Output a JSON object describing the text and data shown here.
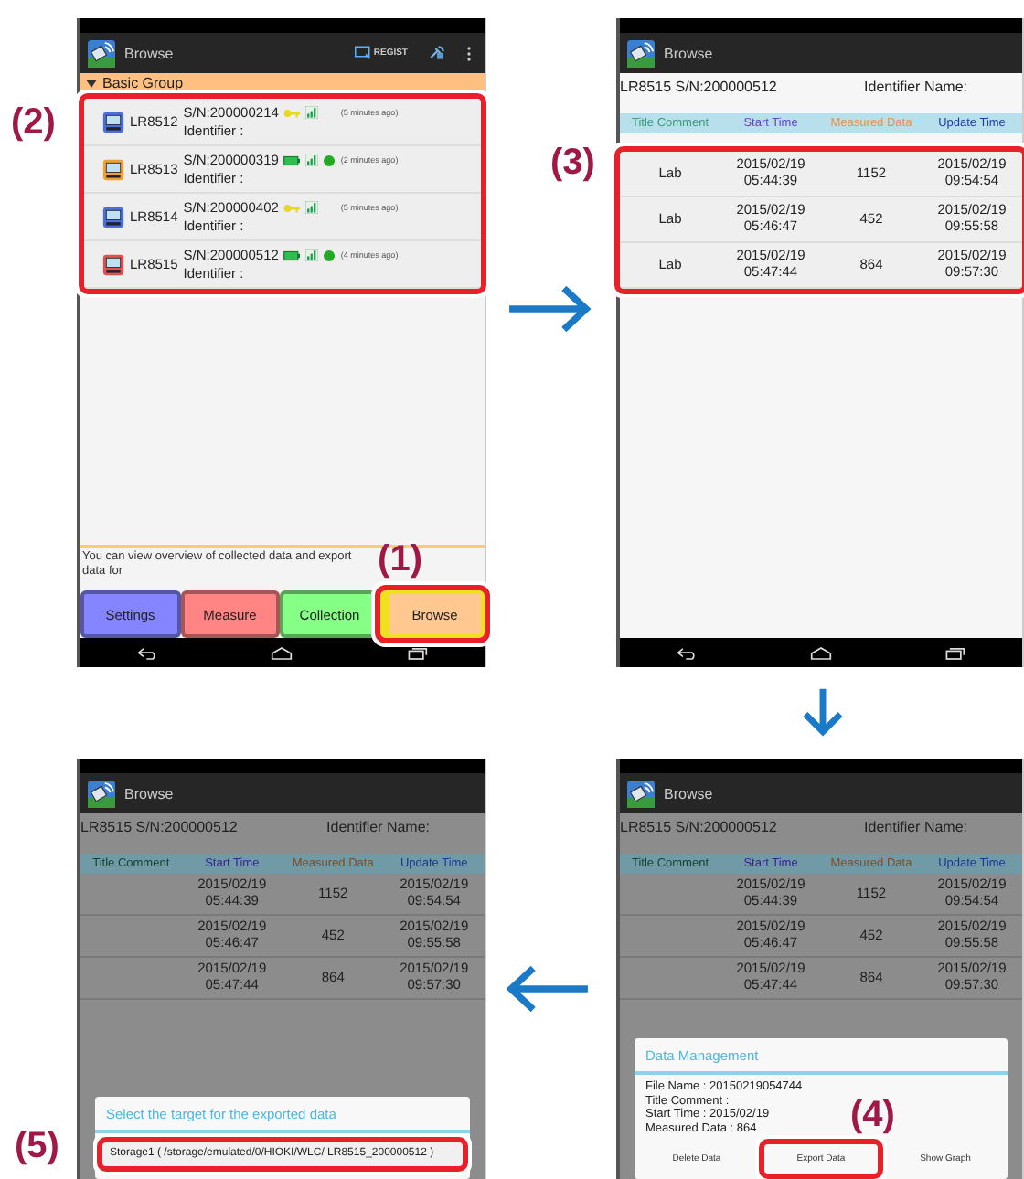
{
  "screens": [
    {
      "kind": "device_list",
      "title": "Browse",
      "regist_label": "REGIST",
      "group": "Basic Group",
      "list_callout": "(2)",
      "devices": [
        {
          "model": "LR8512",
          "serial": "S/N:200000214",
          "identifier": "Identifier :",
          "color": "#4a6fd8",
          "battery_powered": false,
          "online": false,
          "ago": "(5 minutes ago)"
        },
        {
          "model": "LR8513",
          "serial": "S/N:200000319",
          "identifier": "Identifier :",
          "color": "#f0a030",
          "battery_powered": true,
          "online": true,
          "ago": "(2 minutes ago)"
        },
        {
          "model": "LR8514",
          "serial": "S/N:200000402",
          "identifier": "Identifier :",
          "color": "#4a6fd8",
          "battery_powered": false,
          "online": false,
          "ago": "(5 minutes ago)"
        },
        {
          "model": "LR8515",
          "serial": "S/N:200000512",
          "identifier": "Identifier :",
          "color": "#e05050",
          "battery_powered": true,
          "online": true,
          "ago": "(4 minutes ago)"
        }
      ],
      "message": "You can view overview of collected data and export data for",
      "tabs": [
        {
          "label": "Settings",
          "color": "#8585ff",
          "selected": false
        },
        {
          "label": "Measure",
          "color": "#ff8585",
          "selected": false
        },
        {
          "label": "Collection",
          "color": "#85ff85",
          "selected": false
        },
        {
          "label": "Browse",
          "color": "#ffc890",
          "selected": true,
          "callout": "(1)"
        }
      ]
    },
    {
      "kind": "data_table",
      "title": "Browse",
      "dimmed": false,
      "device": "LR8515 S/N:200000512",
      "identifier_label": "Identifier Name:",
      "rows_callout": "(3)",
      "columns": [
        {
          "label": "Title Comment",
          "color": "#3b9a7a"
        },
        {
          "label": "Start Time",
          "color": "#6a3cd0"
        },
        {
          "label": "Measured Data",
          "color": "#e8904a"
        },
        {
          "label": "Update Time",
          "color": "#1f3aa8"
        }
      ],
      "rows": [
        {
          "comment": "Lab",
          "start": "2015/02/19\n05:44:39",
          "measured": "1152",
          "updated": "2015/02/19\n09:54:54"
        },
        {
          "comment": "Lab",
          "start": "2015/02/19\n05:46:47",
          "measured": "452",
          "updated": "2015/02/19\n09:55:58"
        },
        {
          "comment": "Lab",
          "start": "2015/02/19\n05:47:44",
          "measured": "864",
          "updated": "2015/02/19\n09:57:30"
        }
      ]
    },
    {
      "kind": "data_table",
      "title": "Browse",
      "dimmed": true,
      "device": "LR8515 S/N:200000512",
      "identifier_label": "Identifier Name:",
      "columns": [
        {
          "label": "Title Comment",
          "color": "#173f30"
        },
        {
          "label": "Start Time",
          "color": "#3a2290"
        },
        {
          "label": "Measured Data",
          "color": "#8a4a1a"
        },
        {
          "label": "Update Time",
          "color": "#1a3a90"
        }
      ],
      "rows": [
        {
          "start": "2015/02/19\n05:44:39",
          "measured": "1152",
          "updated": "2015/02/19\n09:54:54"
        },
        {
          "start": "2015/02/19\n05:46:47",
          "measured": "452",
          "updated": "2015/02/19\n09:55:58"
        },
        {
          "start": "2015/02/19\n05:47:44",
          "measured": "864",
          "updated": "2015/02/19\n09:57:30"
        }
      ],
      "dialog": {
        "kind": "target_select",
        "title": "Select the target for the exported data",
        "options": [
          {
            "label": "Storage1 ( /storage/emulated/0/HIOKI/WLC/ LR8515_200000512 )",
            "callout": "(5)"
          }
        ]
      }
    },
    {
      "kind": "data_table",
      "title": "Browse",
      "dimmed": true,
      "device": "LR8515 S/N:200000512",
      "identifier_label": "Identifier Name:",
      "columns": [
        {
          "label": "Title Comment",
          "color": "#173f30"
        },
        {
          "label": "Start Time",
          "color": "#3a2290"
        },
        {
          "label": "Measured Data",
          "color": "#8a4a1a"
        },
        {
          "label": "Update Time",
          "color": "#1a3a90"
        }
      ],
      "rows": [
        {
          "start": "2015/02/19\n05:44:39",
          "measured": "1152",
          "updated": "2015/02/19\n09:54:54"
        },
        {
          "start": "2015/02/19\n05:46:47",
          "measured": "452",
          "updated": "2015/02/19\n09:55:58"
        },
        {
          "start": "2015/02/19\n05:47:44",
          "measured": "864",
          "updated": "2015/02/19\n09:57:30"
        }
      ],
      "dialog": {
        "kind": "data_management",
        "title": "Data Management",
        "lines": [
          "File Name : 20150219054744",
          "Title Comment :",
          "Start Time : 2015/02/19",
          "Measured Data : 864"
        ],
        "buttons": [
          {
            "label": "Delete Data"
          },
          {
            "label": "Export Data",
            "callout": "(4)"
          },
          {
            "label": "Show Graph"
          }
        ]
      }
    }
  ]
}
